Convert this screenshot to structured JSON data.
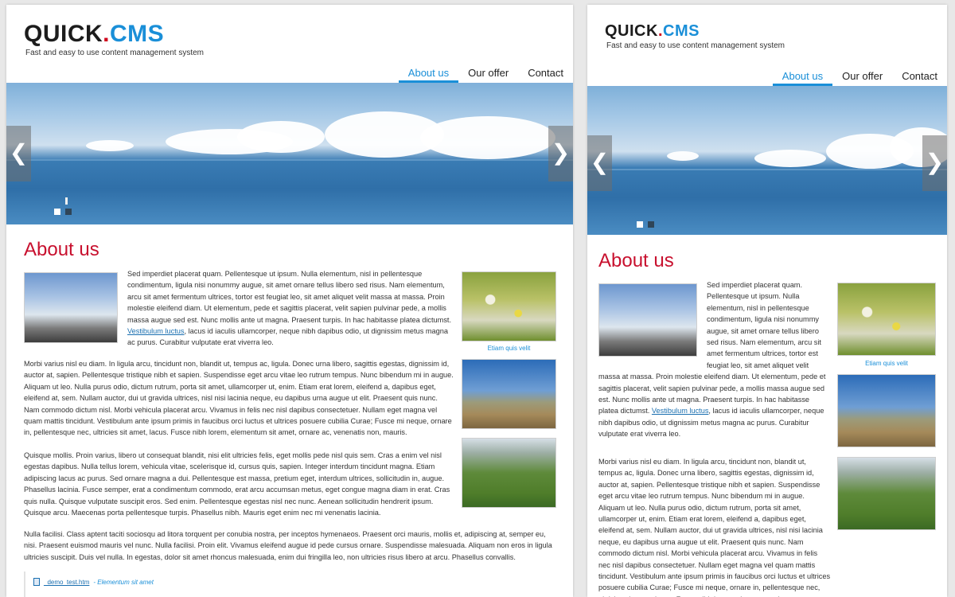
{
  "logo": {
    "quick": "QUICK",
    "dot": ".",
    "cms": "CMS"
  },
  "tagline": "Fast and easy to use content management system",
  "nav": [
    "About us",
    "Our offer",
    "Contact"
  ],
  "slider": {
    "prev_icon": "chevron-left-icon",
    "next_icon": "chevron-right-icon",
    "prev_glyph": "❮",
    "next_glyph": "❯",
    "slide_count": 2,
    "active_slide": 1
  },
  "heading": "About us",
  "caption": "Etiam quis velit",
  "paragraphs": {
    "p1_before_link": "Sed imperdiet placerat quam. Pellentesque ut ipsum. Nulla elementum, nisl in pellentesque condimentum, ligula nisi nonummy augue, sit amet ornare tellus libero sed risus. Nam elementum, arcu sit amet fermentum ultrices, tortor est feugiat leo, sit amet aliquet velit massa at massa. Proin molestie eleifend diam. Ut elementum, pede et sagittis placerat, velit sapien pulvinar pede, a mollis massa augue sed est. Nunc mollis ante ut magna. Praesent turpis. In hac habitasse platea dictumst.",
    "p1_link": "Vestibulum luctus",
    "p1_after_link": ", lacus id iaculis ullamcorper, neque nibh dapibus odio, ut dignissim metus magna ac purus. Curabitur vulputate erat viverra leo.",
    "p2": "Morbi varius nisl eu diam. In ligula arcu, tincidunt non, blandit ut, tempus ac, ligula. Donec urna libero, sagittis egestas, dignissim id, auctor at, sapien. Pellentesque tristique nibh et sapien. Suspendisse eget arcu vitae leo rutrum tempus. Nunc bibendum mi in augue. Aliquam ut leo. Nulla purus odio, dictum rutrum, porta sit amet, ullamcorper ut, enim. Etiam erat lorem, eleifend a, dapibus eget, eleifend at, sem. Nullam auctor, dui ut gravida ultrices, nisl nisi lacinia neque, eu dapibus urna augue ut elit. Praesent quis nunc. Nam commodo dictum nisl. Morbi vehicula placerat arcu. Vivamus in felis nec nisl dapibus consectetuer. Nullam eget magna vel quam mattis tincidunt. Vestibulum ante ipsum primis in faucibus orci luctus et ultrices posuere cubilia Curae; Fusce mi neque, ornare in, pellentesque nec, ultricies sit amet, lacus. Fusce nibh lorem, elementum sit amet, ornare ac, venenatis non, mauris.",
    "p3": "Quisque mollis. Proin varius, libero ut consequat blandit, nisi elit ultricies felis, eget mollis pede nisl quis sem. Cras a enim vel nisl egestas dapibus. Nulla tellus lorem, vehicula vitae, scelerisque id, cursus quis, sapien. Integer interdum tincidunt magna. Etiam adipiscing lacus ac purus. Sed ornare magna a dui. Pellentesque est massa, pretium eget, interdum ultrices, sollicitudin in, augue. Phasellus lacinia. Fusce semper, erat a condimentum commodo, erat arcu accumsan metus, eget congue magna diam in erat. Cras quis nulla. Quisque vulputate suscipit eros. Sed enim. Pellentesque egestas nisl nec nunc. Aenean sollicitudin hendrerit ipsum. Quisque arcu. Maecenas porta pellentesque turpis. Phasellus nibh. Mauris eget enim nec mi venenatis lacinia.",
    "p4": "Nulla facilisi. Class aptent taciti sociosqu ad litora torquent per conubia nostra, per inceptos hymenaeos. Praesent orci mauris, mollis et, adipiscing at, semper eu, nisi. Praesent euismod mauris vel nunc. Nulla facilisi. Proin elit. Vivamus eleifend augue id pede cursus ornare. Suspendisse malesuada. Aliquam non eros in ligula ultricies suscipit. Duis vel nulla. In egestas, dolor sit amet rhoncus malesuada, enim dui fringilla leo, non ultricies risus libero at arcu. Phasellus convallis."
  },
  "file": {
    "name": "_demo_test.htm",
    "separator": " - ",
    "desc": "Elementum sit amet",
    "icon": "document-icon"
  },
  "colors": {
    "accent": "#1a8fd8",
    "heading": "#c8102e",
    "logo_dot": "#d0021b"
  }
}
